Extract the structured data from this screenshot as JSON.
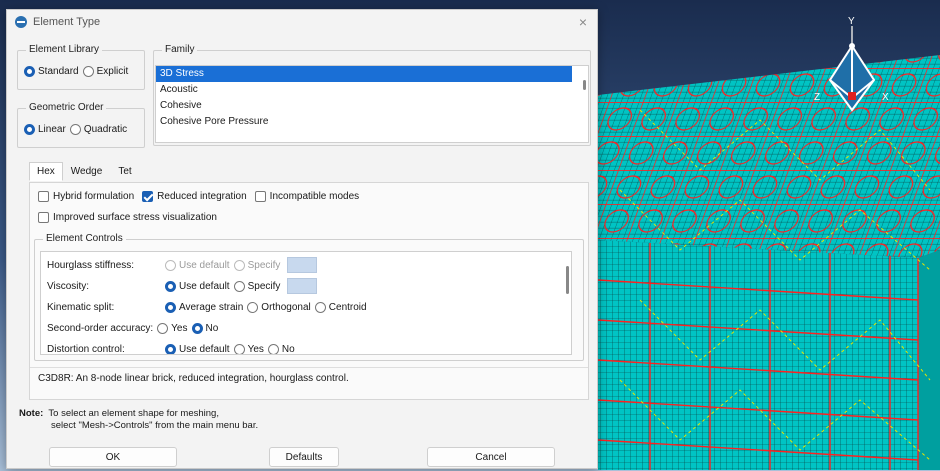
{
  "dialog": {
    "title": "Element Type",
    "close_glyph": "×",
    "icon": "element-type-icon"
  },
  "element_library": {
    "label": "Element Library",
    "options": [
      "Standard",
      "Explicit"
    ],
    "selected": "Standard"
  },
  "geometric_order": {
    "label": "Geometric Order",
    "options": [
      "Linear",
      "Quadratic"
    ],
    "selected": "Linear"
  },
  "family": {
    "label": "Family",
    "items": [
      "3D Stress",
      "Acoustic",
      "Cohesive",
      "Cohesive Pore Pressure"
    ],
    "selected": "3D Stress"
  },
  "tabs": [
    "Hex",
    "Wedge",
    "Tet"
  ],
  "active_tab": "Hex",
  "options": {
    "hybrid": "Hybrid formulation",
    "reduced": "Reduced integration",
    "incompatible": "Incompatible modes",
    "improved": "Improved surface stress visualization"
  },
  "element_controls": {
    "label": "Element Controls",
    "hourglass": {
      "label": "Hourglass stiffness:",
      "opt1": "Use default",
      "opt2": "Specify"
    },
    "viscosity": {
      "label": "Viscosity:",
      "opt1": "Use default",
      "opt2": "Specify"
    },
    "kinematic": {
      "label": "Kinematic split:",
      "opt1": "Average strain",
      "opt2": "Orthogonal",
      "opt3": "Centroid"
    },
    "second_order": {
      "label": "Second-order accuracy:",
      "opt1": "Yes",
      "opt2": "No"
    },
    "distortion": {
      "label": "Distortion control:",
      "opt1": "Use default",
      "opt2": "Yes",
      "opt3": "No"
    }
  },
  "description": "C3D8R:  An 8-node linear brick, reduced integration, hourglass control.",
  "note": {
    "label": "Note:",
    "line1": "To select an element shape for meshing,",
    "line2": "select \"Mesh->Controls\" from the main menu bar."
  },
  "buttons": {
    "ok": "OK",
    "defaults": "Defaults",
    "cancel": "Cancel"
  },
  "triad": {
    "x": "X",
    "y": "Y",
    "z": "Z"
  },
  "colors": {
    "accent": "#1a5fb4",
    "selection": "#1a6fd6",
    "mesh_face": "#00c8c8",
    "mesh_edge": "#ff1e1e"
  }
}
